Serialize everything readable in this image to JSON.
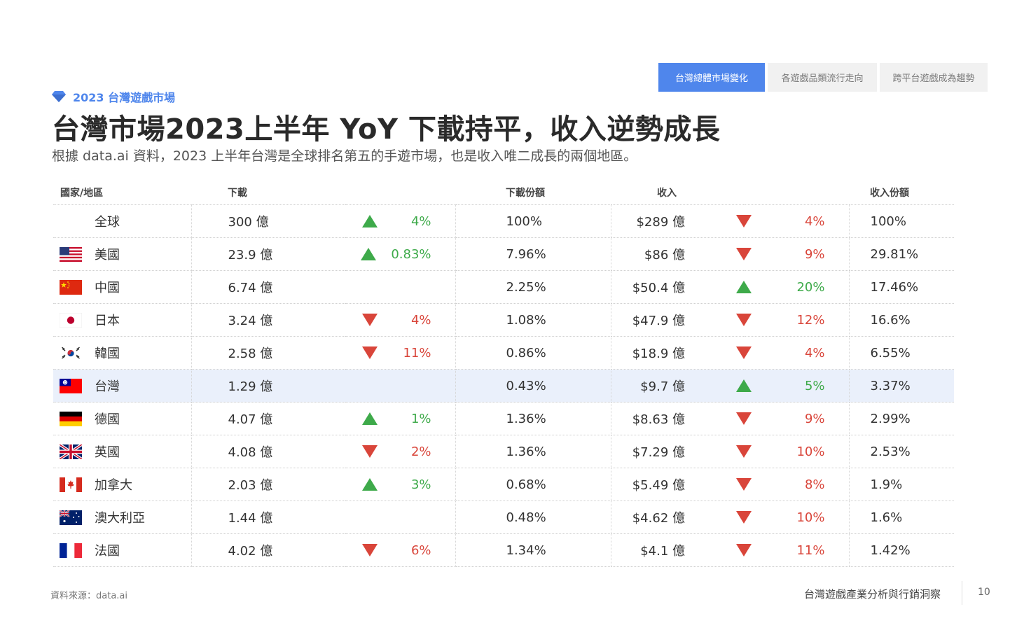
{
  "tabs": [
    {
      "label": "台灣總體市場變化",
      "active": true
    },
    {
      "label": "各遊戲品類流行走向",
      "active": false
    },
    {
      "label": "跨平台遊戲成為趨勢",
      "active": false
    }
  ],
  "eyebrow": "2023 台灣遊戲市場",
  "title": "台灣市場2023上半年 YoY 下載持平，收入逆勢成長",
  "subtitle": "根據 data.ai 資料，2023 上半年台灣是全球排名第五的手遊市場，也是收入唯二成長的兩個地區。",
  "table": {
    "headers": {
      "country": "國家/地區",
      "downloads": "下載",
      "download_share": "下載份額",
      "revenue": "收入",
      "revenue_share": "收入份額"
    },
    "rows": [
      {
        "country": "全球",
        "flag": "none",
        "downloads": "300 億",
        "dl_dir": "up",
        "dl_change": "4%",
        "dl_share": "100%",
        "revenue": "$289 億",
        "rev_dir": "down",
        "rev_change": "4%",
        "rev_share": "100%"
      },
      {
        "country": "美國",
        "flag": "us",
        "downloads": "23.9 億",
        "dl_dir": "up",
        "dl_change": "0.83%",
        "dl_share": "7.96%",
        "revenue": "$86 億",
        "rev_dir": "down",
        "rev_change": "9%",
        "rev_share": "29.81%"
      },
      {
        "country": "中國",
        "flag": "cn",
        "downloads": "6.74 億",
        "dl_dir": "none",
        "dl_change": "",
        "dl_share": "2.25%",
        "revenue": "$50.4 億",
        "rev_dir": "up",
        "rev_change": "20%",
        "rev_share": "17.46%"
      },
      {
        "country": "日本",
        "flag": "jp",
        "downloads": "3.24 億",
        "dl_dir": "down",
        "dl_change": "4%",
        "dl_share": "1.08%",
        "revenue": "$47.9 億",
        "rev_dir": "down",
        "rev_change": "12%",
        "rev_share": "16.6%"
      },
      {
        "country": "韓國",
        "flag": "kr",
        "downloads": "2.58 億",
        "dl_dir": "down",
        "dl_change": "11%",
        "dl_share": "0.86%",
        "revenue": "$18.9 億",
        "rev_dir": "down",
        "rev_change": "4%",
        "rev_share": "6.55%"
      },
      {
        "country": "台灣",
        "flag": "tw",
        "downloads": "1.29 億",
        "dl_dir": "none",
        "dl_change": "",
        "dl_share": "0.43%",
        "revenue": "$9.7 億",
        "rev_dir": "up",
        "rev_change": "5%",
        "rev_share": "3.37%",
        "highlight": true
      },
      {
        "country": "德國",
        "flag": "de",
        "downloads": "4.07 億",
        "dl_dir": "up",
        "dl_change": "1%",
        "dl_share": "1.36%",
        "revenue": "$8.63 億",
        "rev_dir": "down",
        "rev_change": "9%",
        "rev_share": "2.99%"
      },
      {
        "country": "英國",
        "flag": "gb",
        "downloads": "4.08 億",
        "dl_dir": "down",
        "dl_change": "2%",
        "dl_share": "1.36%",
        "revenue": "$7.29 億",
        "rev_dir": "down",
        "rev_change": "10%",
        "rev_share": "2.53%"
      },
      {
        "country": "加拿大",
        "flag": "ca",
        "downloads": "2.03 億",
        "dl_dir": "up",
        "dl_change": "3%",
        "dl_share": "0.68%",
        "revenue": "$5.49 億",
        "rev_dir": "down",
        "rev_change": "8%",
        "rev_share": "1.9%"
      },
      {
        "country": "澳大利亞",
        "flag": "au",
        "downloads": "1.44 億",
        "dl_dir": "none",
        "dl_change": "",
        "dl_share": "0.48%",
        "revenue": "$4.62 億",
        "rev_dir": "down",
        "rev_change": "10%",
        "rev_share": "1.6%"
      },
      {
        "country": "法國",
        "flag": "fr",
        "downloads": "4.02 億",
        "dl_dir": "down",
        "dl_change": "6%",
        "dl_share": "1.34%",
        "revenue": "$4.1 億",
        "rev_dir": "down",
        "rev_change": "11%",
        "rev_share": "1.42%"
      }
    ]
  },
  "footer": {
    "source": "資料來源：data.ai",
    "brand": "台灣遊戲產業分析與行銷洞察",
    "page": "10"
  },
  "colors": {
    "accent": "#4f86ec",
    "up": "#3eaa4a",
    "down": "#d9453a",
    "highlight_row": "#eaf0fb"
  }
}
